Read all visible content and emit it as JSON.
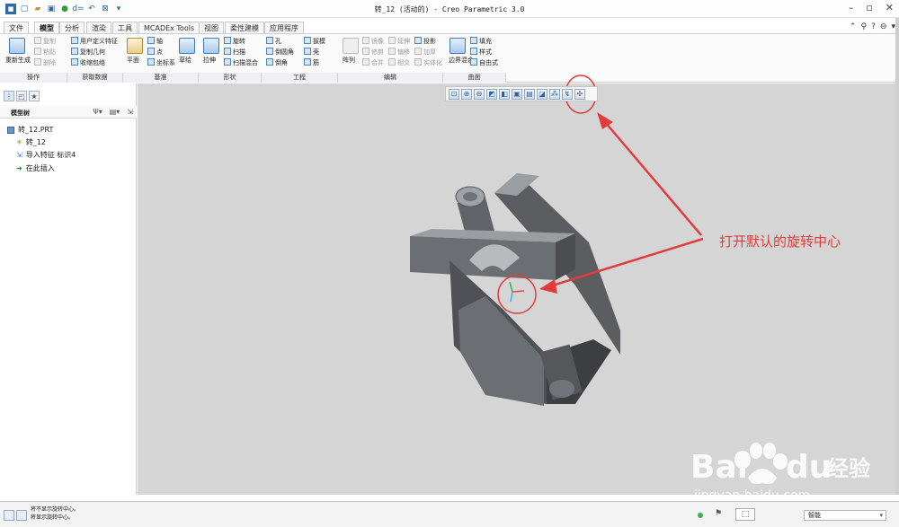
{
  "window": {
    "title": "转_12 (活动的) - Creo Parametric 3.0"
  },
  "tabs": [
    {
      "label": "文件",
      "active": false
    },
    {
      "label": "模型",
      "active": true
    },
    {
      "label": "分析",
      "active": false
    },
    {
      "label": "渲染",
      "active": false
    },
    {
      "label": "工具",
      "active": false
    },
    {
      "label": "MCADEx Tools",
      "active": false
    },
    {
      "label": "视图",
      "active": false
    },
    {
      "label": "柔性建模",
      "active": false
    },
    {
      "label": "应用程序",
      "active": false
    }
  ],
  "ribbon": {
    "regenerate": "重新生成",
    "copy": "复制",
    "paste": "粘贴",
    "delete": "删除",
    "udf": "用户定义特征",
    "copy_geom": "复制几何",
    "shrinkwrap": "收缩包络",
    "plane": "平面",
    "axis": "轴",
    "point": "点",
    "csys": "坐标系",
    "sketch": "草绘",
    "extrude": "拉伸",
    "revolve": "旋转",
    "sweep": "扫描",
    "swept_blend": "扫描混合",
    "hole": "孔",
    "round": "倒圆角",
    "chamfer": "倒角",
    "draft": "拔模",
    "shell": "壳",
    "rib": "筋",
    "pattern": "阵列",
    "mirror": "镜像",
    "trim": "修剪",
    "merge": "合并",
    "extend": "延伸",
    "offset": "偏移",
    "intersect": "相交",
    "project": "投影",
    "thicken": "加厚",
    "solidify": "实体化",
    "boundary_blend": "边界混合",
    "fill": "填充",
    "style": "样式",
    "freestyle": "自由式"
  },
  "groups": [
    "操作",
    "获取数据",
    "基准",
    "形状",
    "工程",
    "编辑",
    "曲面"
  ],
  "tree": {
    "header": "模型树",
    "items": [
      {
        "label": "转_12.PRT",
        "icon": "part-icon"
      },
      {
        "label": "转_12",
        "icon": "csys-icon"
      },
      {
        "label": "导入特征 标识4",
        "icon": "import-feature-icon"
      },
      {
        "label": "在此插入",
        "icon": "insert-here-arrow-icon"
      }
    ]
  },
  "status": {
    "messages": [
      "将不显示旋转中心。",
      "将显示旋转中心。"
    ],
    "filter": "智能"
  },
  "annotation": {
    "text": "打开默认的旋转中心",
    "color": "#e23b3b"
  }
}
